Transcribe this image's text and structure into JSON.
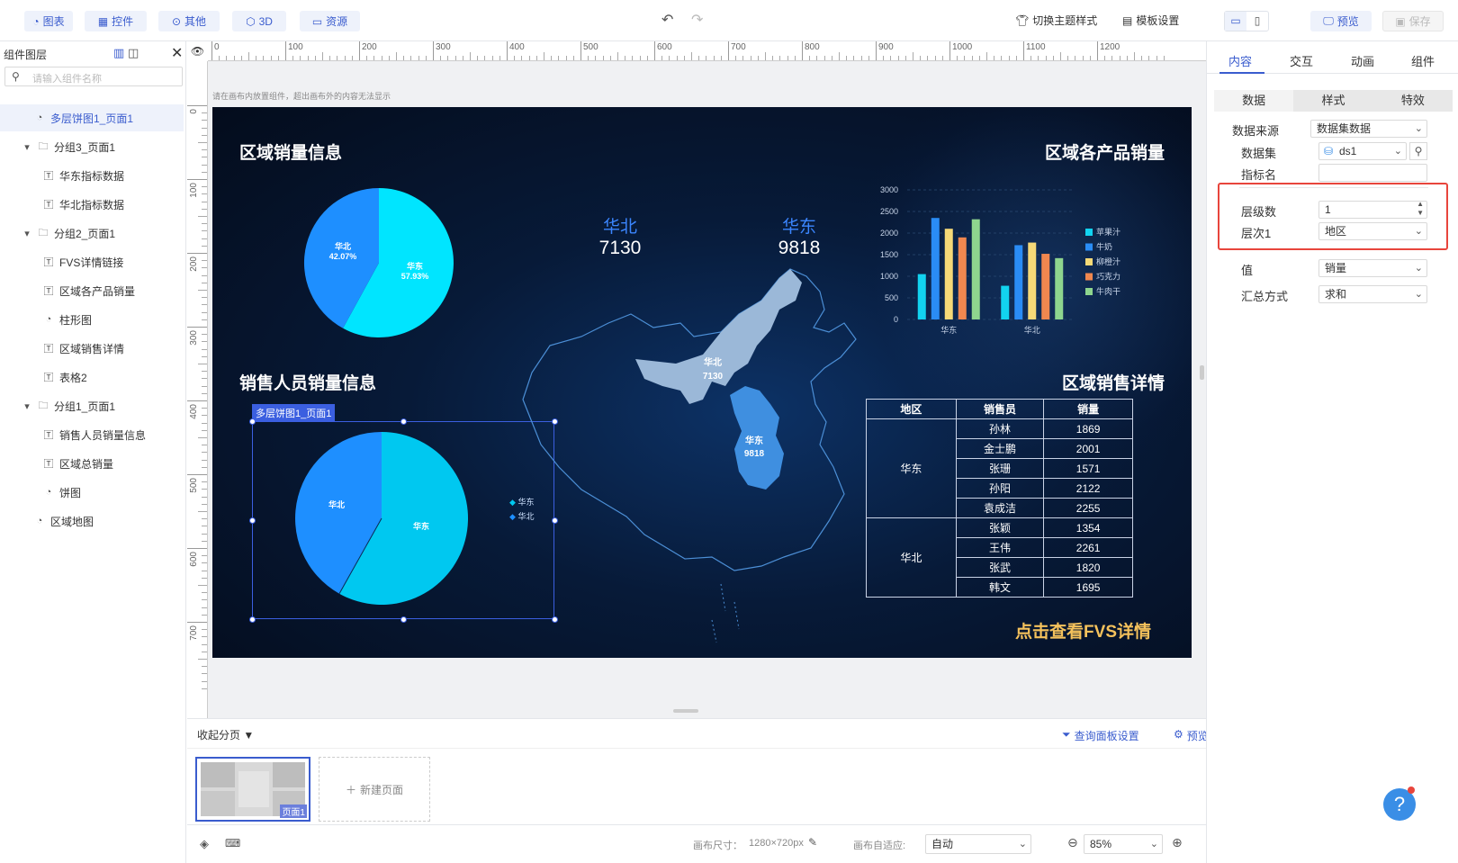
{
  "toolbar": {
    "buttons": [
      {
        "label": "图表",
        "icon": "chart-icon"
      },
      {
        "label": "控件",
        "icon": "widget-icon"
      },
      {
        "label": "其他",
        "icon": "more-icon"
      },
      {
        "label": "3D",
        "icon": "cube-icon"
      },
      {
        "label": "资源",
        "icon": "resource-icon"
      }
    ],
    "theme_label": "切换主题样式",
    "template_label": "模板设置",
    "preview_label": "预览",
    "save_label": "保存"
  },
  "layers": {
    "title": "组件图层",
    "search_placeholder": "请输入组件名称",
    "items": [
      {
        "label": "多层饼图1_页面1",
        "type": "pie",
        "level": 1,
        "selected": true
      },
      {
        "label": "分组3_页面1",
        "type": "group",
        "level": 0
      },
      {
        "label": "华东指标数据",
        "type": "text",
        "level": 1
      },
      {
        "label": "华北指标数据",
        "type": "text",
        "level": 1
      },
      {
        "label": "分组2_页面1",
        "type": "group",
        "level": 0
      },
      {
        "label": "FVS详情链接",
        "type": "text",
        "level": 1
      },
      {
        "label": "区域各产品销量",
        "type": "text",
        "level": 1
      },
      {
        "label": "柱形图",
        "type": "pie",
        "level": 1
      },
      {
        "label": "区域销售详情",
        "type": "text",
        "level": 1
      },
      {
        "label": "表格2",
        "type": "text",
        "level": 1
      },
      {
        "label": "分组1_页面1",
        "type": "group",
        "level": 0
      },
      {
        "label": "销售人员销量信息",
        "type": "text",
        "level": 1
      },
      {
        "label": "区域总销量",
        "type": "text",
        "level": 1
      },
      {
        "label": "饼图",
        "type": "pie",
        "level": 1
      },
      {
        "label": "区域地图",
        "type": "pie",
        "level": 0
      }
    ]
  },
  "ruler": {
    "h_ticks": [
      "0",
      "100",
      "200",
      "300",
      "400",
      "500",
      "600",
      "700",
      "800",
      "900",
      "1000",
      "1100",
      "1200"
    ],
    "v_ticks": [
      "0",
      "100",
      "200",
      "300",
      "400",
      "500",
      "600",
      "700"
    ]
  },
  "canvas_hint": "请在画布内放置组件，超出画布外的内容无法显示",
  "dashboard": {
    "region_sales_title": "区域销量信息",
    "product_sales_title": "区域各产品销量",
    "salesperson_title": "销售人员销量信息",
    "detail_title": "区域销售详情",
    "fvs_link": "点击查看FVS详情",
    "kpis": [
      {
        "label": "华北",
        "value": "7130"
      },
      {
        "label": "华东",
        "value": "9818"
      }
    ],
    "pie1": [
      {
        "name": "华北",
        "pct": "42.07%",
        "color": "#1e8fff"
      },
      {
        "name": "华东",
        "pct": "57.93%",
        "color": "#00e5ff"
      }
    ],
    "pie2": [
      {
        "name": "华北",
        "color": "#1e8fff"
      },
      {
        "name": "华东",
        "color": "#00c8f0"
      }
    ],
    "pie2_legend": [
      "华东",
      "华北"
    ],
    "selected_label": "多层饼图1_页面1",
    "map_labels": [
      {
        "name": "华北",
        "value": "7130"
      },
      {
        "name": "华东",
        "value": "9818"
      }
    ],
    "table": {
      "headers": [
        "地区",
        "销售员",
        "销量"
      ],
      "groups": [
        {
          "region": "华东",
          "rows": [
            [
              "孙林",
              "1869"
            ],
            [
              "金士鹏",
              "2001"
            ],
            [
              "张珊",
              "1571"
            ],
            [
              "孙阳",
              "2122"
            ],
            [
              "袁成洁",
              "2255"
            ]
          ]
        },
        {
          "region": "华北",
          "rows": [
            [
              "张颖",
              "1354"
            ],
            [
              "王伟",
              "2261"
            ],
            [
              "张武",
              "1820"
            ],
            [
              "韩文",
              "1695"
            ]
          ]
        }
      ]
    }
  },
  "chart_data": {
    "type": "bar",
    "categories": [
      "华东",
      "华北"
    ],
    "series": [
      {
        "name": "苹果汁",
        "color": "#12d3f0",
        "values": [
          1050,
          780
        ]
      },
      {
        "name": "牛奶",
        "color": "#2a8cf5",
        "values": [
          2350,
          1720
        ]
      },
      {
        "name": "柳橙汁",
        "color": "#f6d977",
        "values": [
          2100,
          1780
        ]
      },
      {
        "name": "巧克力",
        "color": "#f0874f",
        "values": [
          1900,
          1520
        ]
      },
      {
        "name": "牛肉干",
        "color": "#8ed58e",
        "values": [
          2320,
          1420
        ]
      }
    ],
    "yticks": [
      "3000",
      "2500",
      "2000",
      "1500",
      "1000",
      "500",
      "0"
    ],
    "ylim": [
      0,
      3000
    ],
    "legend": "right",
    "grid": true
  },
  "pages": {
    "collapse_label": "收起分页",
    "query_panel_label": "查询面板设置",
    "preview_play_label": "预览播放设置",
    "page1_label": "页面1",
    "new_page_label": "新建页面"
  },
  "status": {
    "canvas_size_label": "画布尺寸：",
    "canvas_size": "1280×720px",
    "fit_label": "画布自适应:",
    "fit_value": "自动",
    "zoom": "85%"
  },
  "props": {
    "main_tabs": [
      "内容",
      "交互",
      "动画",
      "组件"
    ],
    "sub_tabs": [
      "数据",
      "样式",
      "特效"
    ],
    "fields": [
      {
        "label": "数据来源",
        "value": "数据集数据"
      },
      {
        "label": "数据集",
        "value": "ds1"
      },
      {
        "label": "指标名",
        "value": ""
      },
      {
        "label": "层级数",
        "value": "1"
      },
      {
        "label": "层次1",
        "value": "地区"
      },
      {
        "label": "值",
        "value": "销量"
      },
      {
        "label": "汇总方式",
        "value": "求和"
      }
    ]
  }
}
